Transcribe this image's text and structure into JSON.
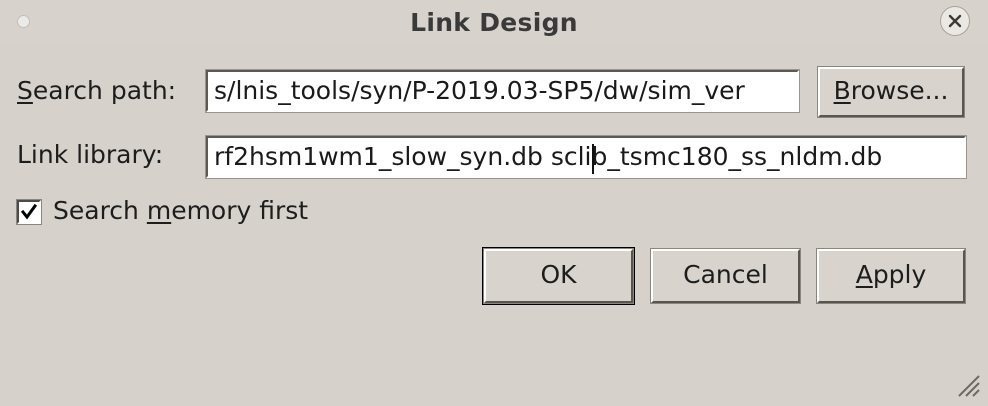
{
  "window": {
    "title": "Link Design"
  },
  "search_path": {
    "label_prefix": "",
    "label_mnemonic": "S",
    "label_rest": "earch path:",
    "value": "s/lnis_tools/syn/P-2019.03-SP5/dw/sim_ver",
    "browse_mnemonic": "B",
    "browse_rest": "rowse..."
  },
  "link_library": {
    "label": "Link library:",
    "value_before_cursor": "rf2hsm1wm1_slow_syn.db scli",
    "value_after_cursor": "b_tsmc180_ss_nldm.db"
  },
  "search_memory": {
    "checked": true,
    "label_prefix": "Search ",
    "label_mnemonic": "m",
    "label_rest": "emory first"
  },
  "buttons": {
    "ok": "OK",
    "cancel": "Cancel",
    "apply_mnemonic": "A",
    "apply_rest": "pply"
  },
  "icons": {
    "close": "close-icon",
    "checkmark": "checkmark-icon",
    "resize": "resize-grip-icon"
  }
}
